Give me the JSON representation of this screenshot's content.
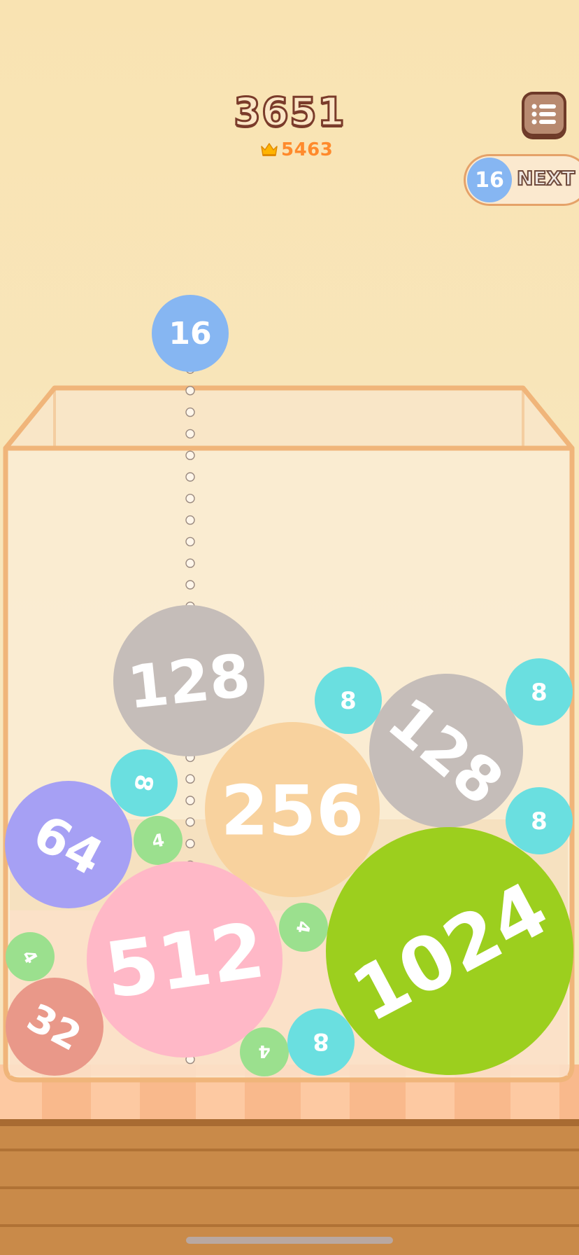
{
  "score": "3651",
  "best": {
    "icon": "crown-icon",
    "value": "5463"
  },
  "menu": {
    "icon": "menu-list-icon"
  },
  "next": {
    "value": "16",
    "label": "NEXT",
    "color": "#86b6f2"
  },
  "dropper": {
    "value": "16",
    "color": "#86b6f2"
  },
  "colors": {
    "4": "#9be08e",
    "8": "#6adfe0",
    "16": "#86b6f2",
    "32": "#e99889",
    "64": "#a6a0f4",
    "128": "#c5bdb9",
    "256": "#f8d29e",
    "512": "#ffb8c7",
    "1024": "#9ccf1e",
    "container_stroke": "#f0b57a"
  },
  "balls": [
    {
      "value": "128"
    },
    {
      "value": "8"
    },
    {
      "value": "128"
    },
    {
      "value": "8"
    },
    {
      "value": "8"
    },
    {
      "value": "256"
    },
    {
      "value": "8"
    },
    {
      "value": "64"
    },
    {
      "value": "4"
    },
    {
      "value": "512"
    },
    {
      "value": "4"
    },
    {
      "value": "4"
    },
    {
      "value": "1024"
    },
    {
      "value": "32"
    },
    {
      "value": "4"
    },
    {
      "value": "8"
    }
  ]
}
